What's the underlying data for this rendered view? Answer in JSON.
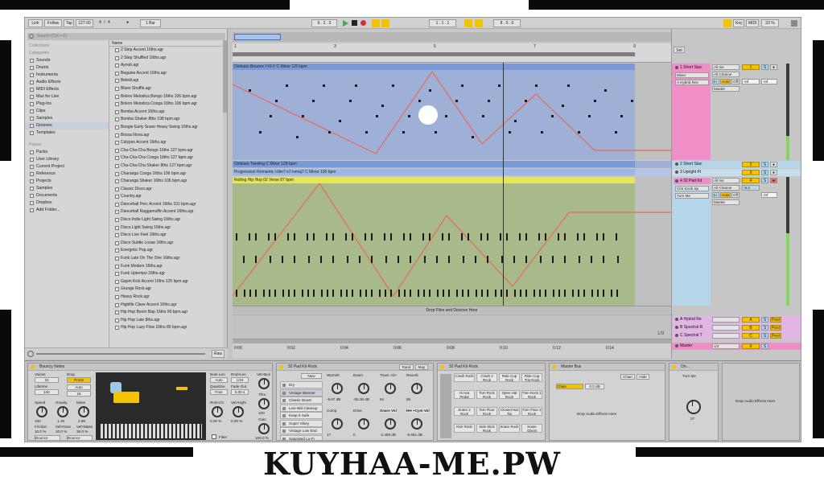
{
  "control_bar": {
    "link": "Link",
    "follow": "Follow",
    "tap": "Tap",
    "tempo": "127.00",
    "signature_num": "4",
    "signature_sep": "/",
    "signature_den": "4",
    "quantize": "1 Bar",
    "arr_position": "6 . 2 . 3",
    "loop_start": "1 . 1 . 1",
    "loop_length": "8 . 0 . 0",
    "key": "Key",
    "midi": "MIDI",
    "cpu": "33 %"
  },
  "browser": {
    "search_placeholder": "Search (Ctrl + F)",
    "collections_header": "Collections",
    "categories_header": "Categories",
    "categories": [
      "Sounds",
      "Drums",
      "Instruments",
      "Audio Effects",
      "MIDI Effects",
      "Max for Live",
      "Plug-Ins",
      "Clips",
      "Samples",
      "Grooves",
      "Templates"
    ],
    "selected_category": "Grooves",
    "places_header": "Places",
    "places": [
      "Packs",
      "User Library",
      "Current Project",
      "Reference",
      "Projects",
      "Samples",
      "Documents",
      "Dropbox",
      "Add Folder..."
    ],
    "name_header": "Name",
    "files": [
      "2 Step Accent 16ths.agr",
      "2 Step Shuffled 16ths.agr",
      "Ayoub.agr",
      "Beguine Accent 16ths.agr",
      "Beledi.agr",
      "Blues Shuffle.agr",
      "Bolero Melodica Bongo 16ths 106 bpm.agr",
      "Bolero Melodica Conga 16ths 106 bpm.agr",
      "Bomba Accent 16ths.agr",
      "Bomba Shaker 8ths 198 bpm.agr",
      "Boogie Early Snare Heavy Swing 16ths.agr",
      "Bossa Nova.agr",
      "Calypso Accent 16ths.agr",
      "Cha-Cha-Cha Bongo 16ths 127 bpm.agr",
      "Cha-Cha-Cha Conga 16ths 127 bpm.agr",
      "Cha-Cha-Cha Shaker 8ths 127 bpm.agr",
      "Charanga Conga 16ths 106 bpm.agr",
      "Charanga Shaker 16ths 106 bpm.agr",
      "Classic Disco.agr",
      "Country.agr",
      "Dancehall Perc Accent 16ths 101 bpm.agr",
      "Dancehall Raggamuffin Accent 16ths.agr",
      "Disco Indie Light Swing 16ths.agr",
      "Disco Light Swing 16ths.agr",
      "Disco Live Feel 16ths.agr",
      "Disco Subtle Loose 16ths.agr",
      "Energetic Pop.agr",
      "Funk Late On The One 16ths.agr",
      "Funk Modern 16ths.agr",
      "Funk Uptempo 16ths.agr",
      "Gqom Kick Accent 16ths 125 bpm.agr",
      "Grunge Rock.agr",
      "Heavy Rock.agr",
      "Highlife Clave Accent 16ths.agr",
      "Hip Hop Boom Bap 16ths 90 bpm.agr",
      "Hip Hop Late 8ths.agr",
      "Hip Hop Lazy Flow 16ths 80 bpm.agr"
    ],
    "raw": "Raw"
  },
  "arrangement": {
    "bars": [
      "1",
      "3",
      "5",
      "7",
      "9"
    ],
    "time_marks": [
      "0:00",
      "0:02",
      "0:04",
      "0:06",
      "0:08",
      "0:10",
      "0:12",
      "0:14"
    ],
    "clip1": "Ostinato Bounce I-VI-V C Minor 120 bpm",
    "clip2": "Ostinato Twisting C Minor 128 bpm",
    "clip3": "Progression Romantic i-iiim7-v7-ivmaj7 C Minor 100 bpm",
    "clip4": "Rolling Hip Hop 02 Verse 87 bpm",
    "drop_text": "Drop Files and Devices Here",
    "zoom": "1/8"
  },
  "mixer": {
    "set": "Set",
    "tracks": [
      {
        "name": "1 Short Stac",
        "color": "#f08ec8",
        "num": "1",
        "input": "All Ins",
        "channel": "All Channe",
        "monitor": "Auto",
        "out": "Master",
        "arm": "Mixer",
        "patch": "A Hybrid Rev",
        "vol": "-inf",
        "pan": "-inf"
      },
      {
        "name": "2 Short Stac",
        "color": "#b6d5e8",
        "num": "2"
      },
      {
        "name": "3 Upright Pi",
        "color": "#b6d5e8",
        "num": "3"
      },
      {
        "name": "4 32 Pad Kit",
        "color": "#f08ec8",
        "num": "4",
        "input": "All Ins",
        "channel": "All Channe",
        "monitor": "Auto",
        "out": "Master",
        "arm": "Chs Knob Sp",
        "patch": "Turn Me",
        "vol": "-6.2",
        "pan": "-inf"
      }
    ],
    "off": "Off",
    "in": "In",
    "returns": [
      {
        "name": "A Hybrid Re",
        "letter": "A"
      },
      {
        "name": "B Spectral R",
        "letter": "B"
      },
      {
        "name": "C Spectral T",
        "letter": "C"
      }
    ],
    "master": "Master",
    "master_val": "1/2",
    "post": "Post"
  },
  "devices": {
    "bouncy": {
      "title": "Bouncy Notes",
      "voices_lbl": "Voices",
      "voices": "16",
      "drop_lbl": "Drop",
      "drop": "Press",
      "lifetime_lbl": "Lifetime",
      "lifetime": "100",
      "auto": "Auto",
      "auto_val": "16",
      "speed_lbl": "Speed",
      "speed": "100",
      "gravity_lbl": "Gravity",
      "gravity": "1.19",
      "mass_lbl": "Mass",
      "mass": "2.68",
      "friction_lbl": "Friction",
      "friction": "10.0 %",
      "velgrav_lbl": "Vel>Grav",
      "velgrav": "10.0 %",
      "velmass_lbl": "Vel>Mass",
      "velmass": "36.0 %",
      "bounce1": "Bounce",
      "bounce2": "Bounce",
      "note_len_lbl": "Note Len",
      "note_len": "Auto",
      "rnd_len_lbl": "Rnd>Len",
      "rnd_len": "1/16",
      "quantize_lbl": "Quantize",
      "quantize": "Free",
      "fade_out_lbl": "Fade Out",
      "fade_out": "0.00 s",
      "rnd_ctr_lbl": "Rnd>Ctr",
      "rnd_ctr": "0.00 %",
      "vel_hght_lbl": "Vel>Hght",
      "vel_hght": "0.00 %",
      "vel_buil_lbl": "Vel>Buil",
      "thru_lbl": "Thru",
      "thru": "100",
      "gain_lbl": "Gain",
      "gain": "100.0 %",
      "filter": "Filter"
    },
    "rack": {
      "title": "32 Pad Kit Rock",
      "new": "New",
      "presets": [
        "Dry",
        "Vintage Warmer",
        "Classic Boost",
        "Low Mid Cleanup",
        "Keep It Safe",
        "Super Vibey",
        "Vintage Low End",
        "Saturated Lo-Fi"
      ],
      "macros": [
        {
          "name": "Warmth",
          "val": "-9.67 dB"
        },
        {
          "name": "Boom",
          "val": "-55.36 dB"
        },
        {
          "name": "Trans <0>",
          "val": "64"
        },
        {
          "name": "Reverb",
          "val": "85"
        },
        {
          "name": "Comp",
          "val": "17"
        },
        {
          "name": "Drive",
          "val": "0"
        },
        {
          "name": "Snare Vol",
          "val": "-2.409 dB"
        },
        {
          "name": "HH +Cym Vol",
          "val": "-5.651 dB"
        }
      ],
      "rand": "Rand",
      "map": "Map"
    },
    "drumrack": {
      "title": "32 Pad Kit Rock",
      "pads": [
        "Crash Rock",
        "Crash 2 Rock",
        "Ride Cup Rock",
        "Ride Cup Trip Rock",
        "Hi Hat Pedal",
        "Tom Rock Rock",
        "Open Hat Rock",
        "Tom Rock 2 Rock",
        "Snare 2 Rock",
        "Tom Floor Rock",
        "Closed Hat Tip",
        "Tom Floor 2 Rock",
        "Kick Rock",
        "Side Stick Rock",
        "Snare Rock",
        "Snare Ghost"
      ]
    },
    "master": {
      "title": "Master Bus",
      "chain": "Chain",
      "chain_val": "0.0 dB",
      "chain_btn": "Chain",
      "hide": "Hide",
      "drop": "Drop Audio Effects Here"
    },
    "on": {
      "title": "On...",
      "turn": "Turn Me",
      "val": "27"
    },
    "drop2": "Drop Audio Effects Here"
  },
  "watermark": "KUYHAA-ME.PW"
}
